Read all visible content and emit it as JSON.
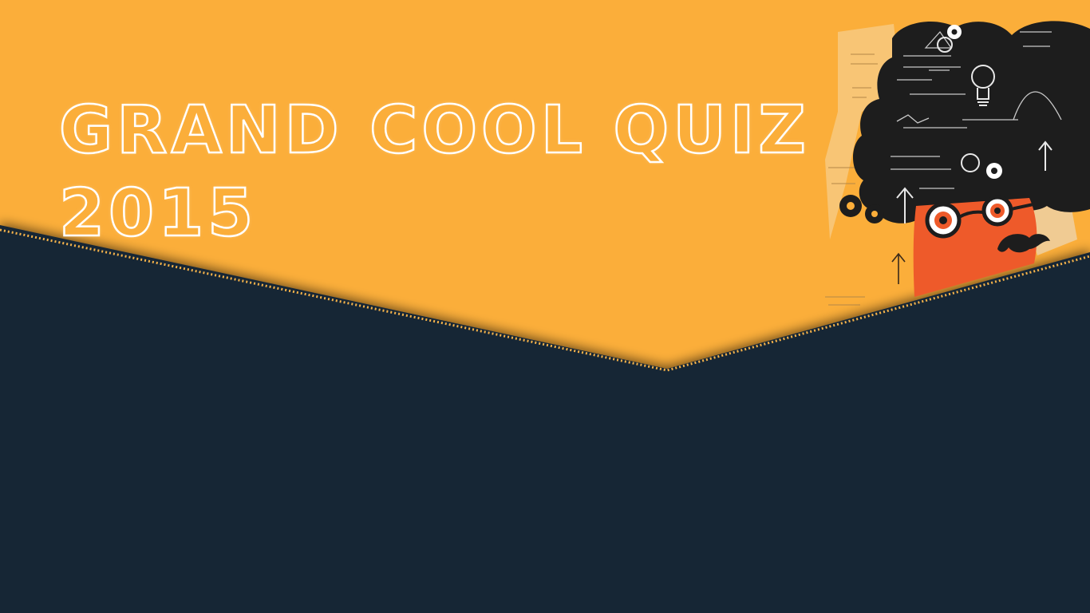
{
  "slide": {
    "title_line1": "Grand Cool Quiz",
    "title_line2": "2015"
  },
  "colors": {
    "background_orange": "#FBAE3A",
    "background_navy": "#182535",
    "dotted_border": "#F4B24A",
    "title_outline": "#FFFFFF",
    "character_face": "#EE5A2A",
    "chalkboard_hair": "#1D1D1D"
  },
  "illustration": {
    "description_icon": "professor-chalkboard-illustration"
  }
}
